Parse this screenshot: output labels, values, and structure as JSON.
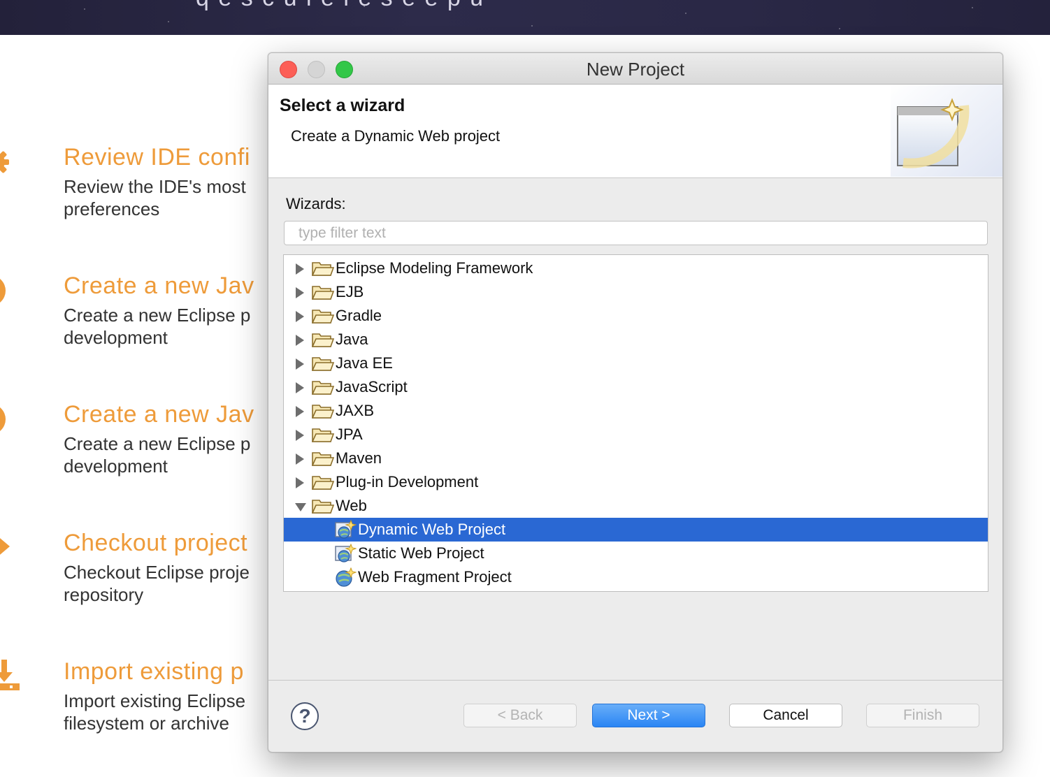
{
  "background": {
    "banner_text": "q e s c u   i   e   i e s e   e p u",
    "items": [
      {
        "title": "Review IDE confi",
        "desc_line1": "Review the IDE's most",
        "desc_line2": "preferences",
        "icon": "gear-icon"
      },
      {
        "title": "Create a new Jav",
        "desc_line1": "Create a new Eclipse p",
        "desc_line2": "development",
        "icon": "plus-circle-icon"
      },
      {
        "title": "Create a new Jav",
        "desc_line1": "Create a new Eclipse p",
        "desc_line2": "development",
        "icon": "plus-circle-icon"
      },
      {
        "title": "Checkout project",
        "desc_line1": "Checkout Eclipse proje",
        "desc_line2": "repository",
        "icon": "git-icon"
      },
      {
        "title": "Import existing p",
        "desc_line1": "Import existing Eclipse",
        "desc_line2": "filesystem or archive",
        "icon": "import-icon"
      }
    ],
    "accent_color": "#ee9b3a"
  },
  "dialog": {
    "window_title": "New Project",
    "header": {
      "title": "Select a wizard",
      "description": "Create a Dynamic Web project"
    },
    "wizards_label": "Wizards:",
    "filter": {
      "placeholder": "type filter text",
      "value": ""
    },
    "tree": [
      {
        "label": "Eclipse Modeling Framework",
        "type": "folder",
        "expanded": false
      },
      {
        "label": "EJB",
        "type": "folder",
        "expanded": false
      },
      {
        "label": "Gradle",
        "type": "folder",
        "expanded": false
      },
      {
        "label": "Java",
        "type": "folder",
        "expanded": false
      },
      {
        "label": "Java EE",
        "type": "folder",
        "expanded": false
      },
      {
        "label": "JavaScript",
        "type": "folder",
        "expanded": false
      },
      {
        "label": "JAXB",
        "type": "folder",
        "expanded": false
      },
      {
        "label": "JPA",
        "type": "folder",
        "expanded": false
      },
      {
        "label": "Maven",
        "type": "folder",
        "expanded": false
      },
      {
        "label": "Plug-in Development",
        "type": "folder",
        "expanded": false
      },
      {
        "label": "Web",
        "type": "folder",
        "expanded": true
      },
      {
        "label": "Dynamic Web Project",
        "type": "wizard",
        "selected": true
      },
      {
        "label": "Static Web Project",
        "type": "wizard",
        "selected": false
      },
      {
        "label": "Web Fragment Project",
        "type": "wizard",
        "selected": false
      }
    ],
    "buttons": {
      "help": "?",
      "back": "< Back",
      "next": "Next >",
      "cancel": "Cancel",
      "finish": "Finish"
    },
    "selection_color": "#2a68d3"
  }
}
